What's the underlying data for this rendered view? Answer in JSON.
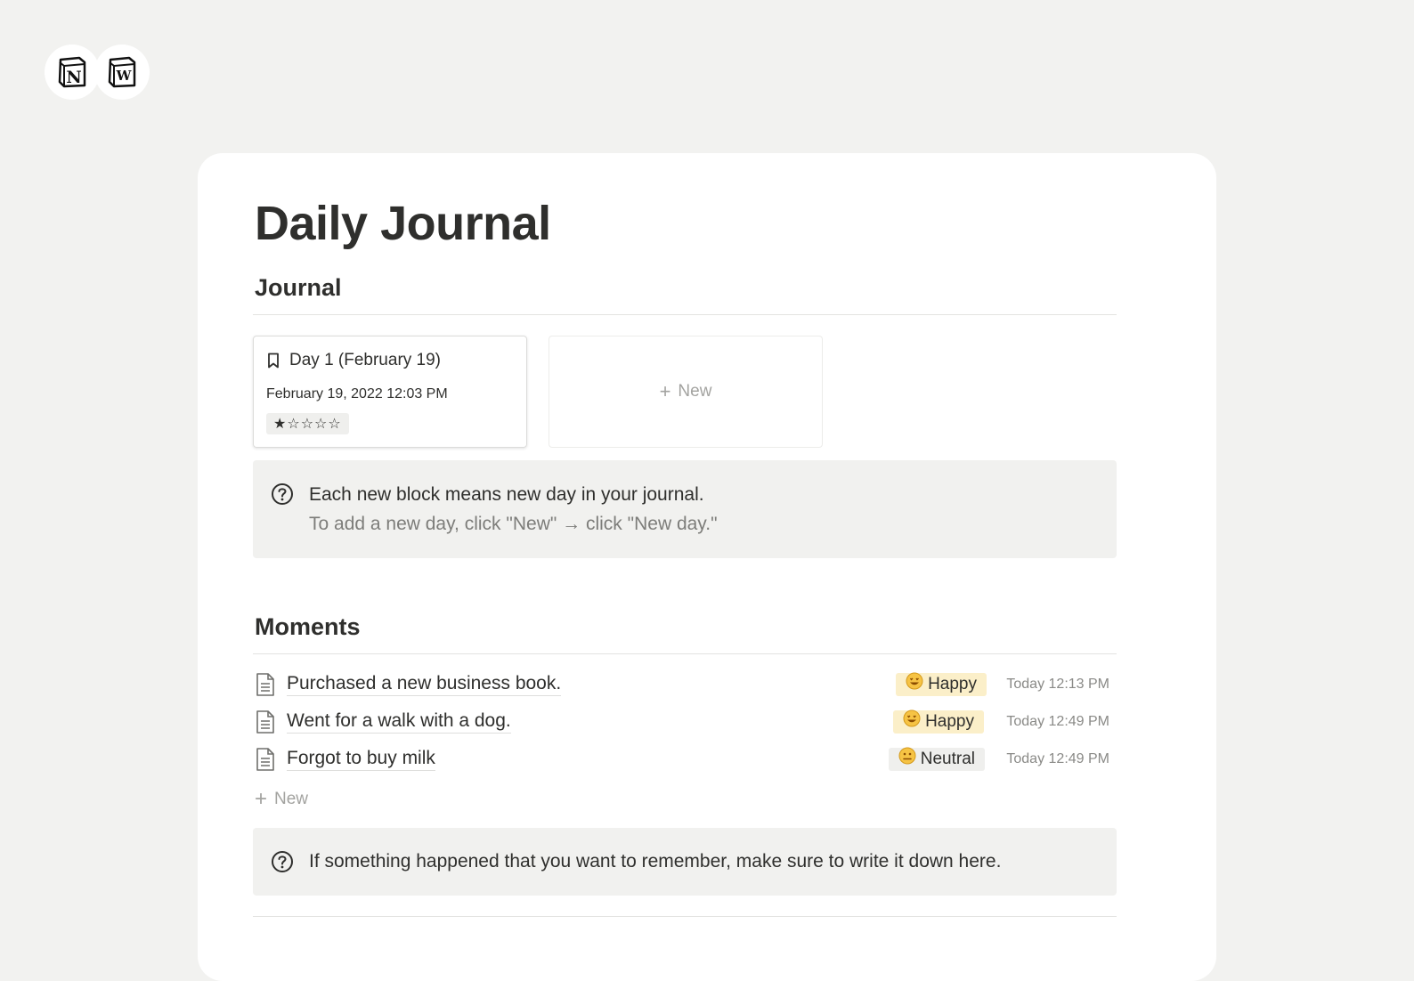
{
  "logos": [
    {
      "icon": "notion-logo-icon",
      "letter": "N"
    },
    {
      "icon": "word-logo-icon",
      "letter": "W"
    }
  ],
  "page": {
    "title": "Daily Journal"
  },
  "journal": {
    "heading": "Journal",
    "entries": [
      {
        "title": "Day 1 (February 19)",
        "date": "February 19, 2022 12:03 PM",
        "rating": "★☆☆☆☆",
        "rating_value": 1,
        "icon": "bookmark-icon"
      }
    ],
    "new_label": "New",
    "callout": {
      "icon": "question-circle-icon",
      "line1": "Each new block means new day in your journal.",
      "line2": "To add a new day, click \"New\" → click \"New day.\""
    }
  },
  "moments": {
    "heading": "Moments",
    "rows": [
      {
        "title": "Purchased a new business book.",
        "mood": "Happy",
        "mood_icon": "grinning-star-eyes-icon",
        "time": "Today 12:13 PM",
        "icon": "document-icon"
      },
      {
        "title": "Went for a walk with a dog.",
        "mood": "Happy",
        "mood_icon": "grinning-star-eyes-icon",
        "time": "Today 12:49 PM",
        "icon": "document-icon"
      },
      {
        "title": "Forgot to buy milk",
        "mood": "Neutral",
        "mood_icon": "neutral-face-icon",
        "time": "Today 12:49 PM",
        "icon": "document-icon"
      }
    ],
    "new_label": "New",
    "callout": {
      "icon": "question-circle-icon",
      "line1": "If something happened that you want to remember, make sure to write it down here."
    }
  },
  "colors": {
    "background": "#f2f2f0",
    "card": "#ffffff",
    "text": "#2f2f2d",
    "muted": "#8a8a87",
    "callout": "#f1f1ef",
    "tag_happy": "#fbefc9",
    "tag_neutral": "#efefed"
  }
}
